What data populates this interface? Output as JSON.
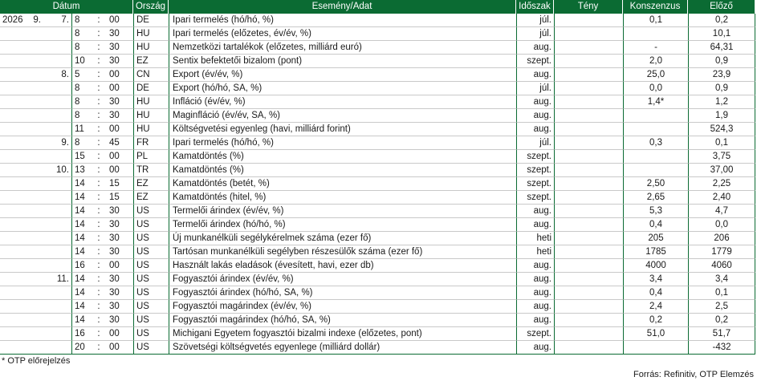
{
  "headers": {
    "datum": "Dátum",
    "orszag": "Ország",
    "esemeny": "Esemény/Adat",
    "idoszak": "Időszak",
    "teny": "Tény",
    "konszenzus": "Konszenzus",
    "elozo": "Előző"
  },
  "rows": [
    {
      "year": "2026",
      "month": "9.",
      "day": "7.",
      "h": "8",
      "sep": ":",
      "m": "00",
      "country": "DE",
      "event": "Ipari termelés (hó/hó, %)",
      "period": "júl.",
      "actual": "",
      "consensus": "0,1",
      "previous": "0,2"
    },
    {
      "year": "",
      "month": "",
      "day": "",
      "h": "8",
      "sep": ":",
      "m": "30",
      "country": "HU",
      "event": "Ipari termelés (előzetes, év/év, %)",
      "period": "júl.",
      "actual": "",
      "consensus": "",
      "previous": "10,1"
    },
    {
      "year": "",
      "month": "",
      "day": "",
      "h": "8",
      "sep": ":",
      "m": "30",
      "country": "HU",
      "event": "Nemzetközi tartalékok (előzetes, milliárd euró)",
      "period": "aug.",
      "actual": "",
      "consensus": "-",
      "previous": "64,31"
    },
    {
      "year": "",
      "month": "",
      "day": "",
      "h": "10",
      "sep": ":",
      "m": "30",
      "country": "EZ",
      "event": "Sentix befektetői bizalom (pont)",
      "period": "szept.",
      "actual": "",
      "consensus": "2,0",
      "previous": "0,9"
    },
    {
      "year": "",
      "month": "",
      "day": "8.",
      "h": "5",
      "sep": ":",
      "m": "00",
      "country": "CN",
      "event": "Export (év/év, %)",
      "period": "aug.",
      "actual": "",
      "consensus": "25,0",
      "previous": "23,9"
    },
    {
      "year": "",
      "month": "",
      "day": "",
      "h": "8",
      "sep": ":",
      "m": "00",
      "country": "DE",
      "event": "Export (hó/hó, SA, %)",
      "period": "júl.",
      "actual": "",
      "consensus": "0,0",
      "previous": "0,9"
    },
    {
      "year": "",
      "month": "",
      "day": "",
      "h": "8",
      "sep": ":",
      "m": "30",
      "country": "HU",
      "event": "Infláció (év/év, %)",
      "period": "aug.",
      "actual": "",
      "consensus": "1,4*",
      "previous": "1,2"
    },
    {
      "year": "",
      "month": "",
      "day": "",
      "h": "8",
      "sep": ":",
      "m": "30",
      "country": "HU",
      "event": "Maginfláció (év/év, SA, %)",
      "period": "aug.",
      "actual": "",
      "consensus": "",
      "previous": "1,9"
    },
    {
      "year": "",
      "month": "",
      "day": "",
      "h": "11",
      "sep": ":",
      "m": "00",
      "country": "HU",
      "event": "Költségvetési egyenleg (havi, milliárd forint)",
      "period": "aug.",
      "actual": "",
      "consensus": "",
      "previous": "524,3"
    },
    {
      "year": "",
      "month": "",
      "day": "9.",
      "h": "8",
      "sep": ":",
      "m": "45",
      "country": "FR",
      "event": "Ipari termelés (hó/hó, %)",
      "period": "júl.",
      "actual": "",
      "consensus": "0,3",
      "previous": "0,1"
    },
    {
      "year": "",
      "month": "",
      "day": "",
      "h": "15",
      "sep": ":",
      "m": "00",
      "country": "PL",
      "event": "Kamatdöntés (%)",
      "period": "szept.",
      "actual": "",
      "consensus": "",
      "previous": "3,75"
    },
    {
      "year": "",
      "month": "",
      "day": "10.",
      "h": "13",
      "sep": ":",
      "m": "00",
      "country": "TR",
      "event": "Kamatdöntés (%)",
      "period": "szept.",
      "actual": "",
      "consensus": "",
      "previous": "37,00"
    },
    {
      "year": "",
      "month": "",
      "day": "",
      "h": "14",
      "sep": ":",
      "m": "15",
      "country": "EZ",
      "event": "Kamatdöntés (betét, %)",
      "period": "szept.",
      "actual": "",
      "consensus": "2,50",
      "previous": "2,25"
    },
    {
      "year": "",
      "month": "",
      "day": "",
      "h": "14",
      "sep": ":",
      "m": "15",
      "country": "EZ",
      "event": "Kamatdöntés (hitel, %)",
      "period": "szept.",
      "actual": "",
      "consensus": "2,65",
      "previous": "2,40"
    },
    {
      "year": "",
      "month": "",
      "day": "",
      "h": "14",
      "sep": ":",
      "m": "30",
      "country": "US",
      "event": "Termelői árindex (év/év, %)",
      "period": "aug.",
      "actual": "",
      "consensus": "5,3",
      "previous": "4,7"
    },
    {
      "year": "",
      "month": "",
      "day": "",
      "h": "14",
      "sep": ":",
      "m": "30",
      "country": "US",
      "event": "Termelői árindex (hó/hó, %)",
      "period": "aug.",
      "actual": "",
      "consensus": "0,4",
      "previous": "0,0"
    },
    {
      "year": "",
      "month": "",
      "day": "",
      "h": "14",
      "sep": ":",
      "m": "30",
      "country": "US",
      "event": "Új munkanélküli segélykérelmek száma (ezer fő)",
      "period": "heti",
      "actual": "",
      "consensus": "205",
      "previous": "206"
    },
    {
      "year": "",
      "month": "",
      "day": "",
      "h": "14",
      "sep": ":",
      "m": "30",
      "country": "US",
      "event": "Tartósan munkanélküli segélyben részesülők száma (ezer fő)",
      "period": "heti",
      "actual": "",
      "consensus": "1785",
      "previous": "1779"
    },
    {
      "year": "",
      "month": "",
      "day": "",
      "h": "16",
      "sep": ":",
      "m": "00",
      "country": "US",
      "event": "Használt lakás eladások (évesített, havi, ezer db)",
      "period": "aug.",
      "actual": "",
      "consensus": "4000",
      "previous": "4060"
    },
    {
      "year": "",
      "month": "",
      "day": "11.",
      "h": "14",
      "sep": ":",
      "m": "30",
      "country": "US",
      "event": "Fogyasztói árindex (év/év, %)",
      "period": "aug.",
      "actual": "",
      "consensus": "3,4",
      "previous": "3,4"
    },
    {
      "year": "",
      "month": "",
      "day": "",
      "h": "14",
      "sep": ":",
      "m": "30",
      "country": "US",
      "event": "Fogyasztói árindex (hó/hó, SA, %)",
      "period": "aug.",
      "actual": "",
      "consensus": "0,4",
      "previous": "0,1"
    },
    {
      "year": "",
      "month": "",
      "day": "",
      "h": "14",
      "sep": ":",
      "m": "30",
      "country": "US",
      "event": "Fogyasztói magárindex (év/év, %)",
      "period": "aug.",
      "actual": "",
      "consensus": "2,4",
      "previous": "2,5"
    },
    {
      "year": "",
      "month": "",
      "day": "",
      "h": "14",
      "sep": ":",
      "m": "30",
      "country": "US",
      "event": "Fogyasztói magárindex (hó/hó, SA, %)",
      "period": "aug.",
      "actual": "",
      "consensus": "0,2",
      "previous": "0,2"
    },
    {
      "year": "",
      "month": "",
      "day": "",
      "h": "16",
      "sep": ":",
      "m": "00",
      "country": "US",
      "event": "Michigani Egyetem fogyasztói bizalmi indexe (előzetes, pont)",
      "period": "szept.",
      "actual": "",
      "consensus": "51,0",
      "previous": "51,7"
    },
    {
      "year": "",
      "month": "",
      "day": "",
      "h": "20",
      "sep": ":",
      "m": "00",
      "country": "US",
      "event": "Szövetségi költségvetés egyenlege (milliárd dollár)",
      "period": "aug.",
      "actual": "",
      "consensus": "",
      "previous": "-432"
    }
  ],
  "footnote": "* OTP előrejelzés",
  "source": "Forrás: Refinitiv, OTP Elemzés",
  "colors": {
    "header_bg": "#0b6b33",
    "header_text": "#ffffff",
    "line": "#0b6b33"
  }
}
